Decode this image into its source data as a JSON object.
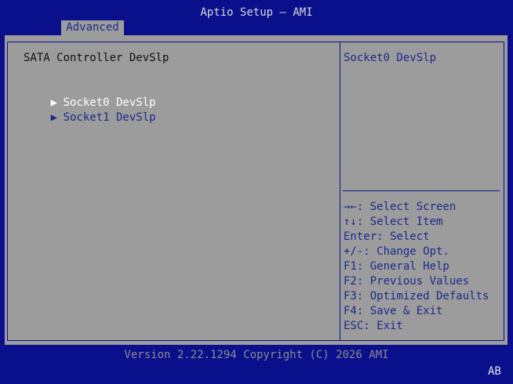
{
  "window": {
    "title": "Aptio Setup – AMI"
  },
  "tabs": [
    {
      "label": "Advanced",
      "active": true
    }
  ],
  "main": {
    "section_title": "SATA Controller DevSlp",
    "items": [
      {
        "arrow": "▶",
        "label": "Socket0 DevSlp",
        "selected": true
      },
      {
        "arrow": "▶",
        "label": "Socket1 DevSlp",
        "selected": false
      }
    ]
  },
  "help": {
    "text": "Socket0 DevSlp",
    "keys": [
      "→←: Select Screen",
      "↑↓: Select Item",
      "Enter: Select",
      "+/-: Change Opt.",
      "F1: General Help",
      "F2: Previous Values",
      "F3: Optimized Defaults",
      "F4: Save & Exit",
      "ESC: Exit"
    ]
  },
  "footer": {
    "version": "Version 2.22.1294 Copyright (C) 2026 AMI",
    "badge": "AB"
  },
  "colors": {
    "frame_blue": "#0a0f8c",
    "panel_gray": "#9c9c9c",
    "text_blue": "#1a2a8c",
    "selected_white": "#ffffff"
  }
}
